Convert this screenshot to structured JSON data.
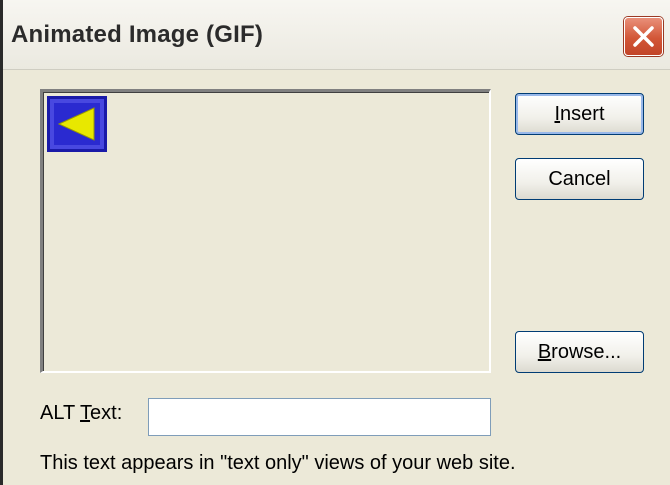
{
  "window": {
    "title": "Animated Image (GIF)"
  },
  "buttons": {
    "insert_label": "Insert",
    "insert_mnemonic": "I",
    "insert_rest": "nsert",
    "cancel_label": "Cancel",
    "browse_label": "Browse...",
    "browse_mnemonic": "B",
    "browse_rest": "rowse..."
  },
  "alt_text": {
    "label": "ALT Text:",
    "label_prefix": "ALT ",
    "label_mnemonic": "T",
    "label_rest": "ext:",
    "value": ""
  },
  "hint": "This text appears in \"text only\" views of your web site.",
  "icons": {
    "close": "close-icon",
    "preview_gif": "left-arrow-gif-icon"
  },
  "colors": {
    "gif_frame": "#1a1aa8",
    "gif_fill": "#2a2ad0",
    "gif_arrow": "#e8e800",
    "close_button": "#d25637"
  }
}
